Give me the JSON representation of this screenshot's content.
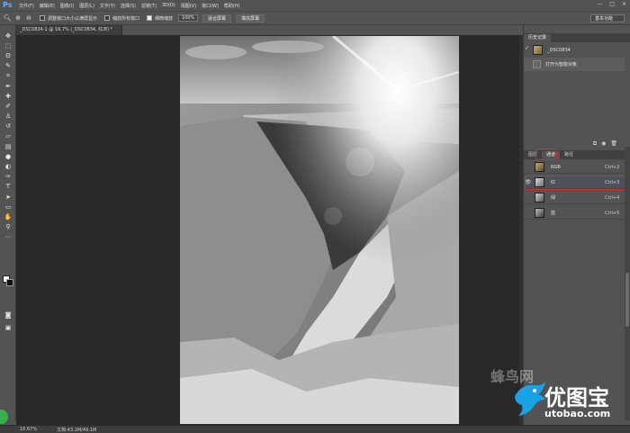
{
  "app": {
    "logo": "Ps"
  },
  "menu": [
    "文件(F)",
    "编辑(E)",
    "图像(I)",
    "图层(L)",
    "文字(Y)",
    "选择(S)",
    "滤镜(T)",
    "3D(D)",
    "视图(V)",
    "窗口(W)",
    "帮助(H)"
  ],
  "window_controls": [
    "—",
    "□",
    "×"
  ],
  "options": {
    "resize_windows_label": "调整窗口大小以满屏显示",
    "zoom_all_label": "缩放所有窗口",
    "scrubby_zoom_label": "细微缩放",
    "zoom_value": "100%",
    "fit_screen_label": "适合屏幕",
    "fill_screen_label": "填充屏幕",
    "workspace": "基本功能"
  },
  "document": {
    "tab_title": "_DSC0834-1 @ 16.7% (_DSC0834, 红/8) *",
    "status_zoom": "16.67%",
    "status_doc": "文档:43.1M/49.1M"
  },
  "history": {
    "tabs": [
      "历史记录"
    ],
    "snapshot_name": "_DSC0834",
    "action_label": "打开为智能对象"
  },
  "channels": {
    "tabs": [
      "图层",
      "通道",
      "路径"
    ],
    "active_tab": "通道",
    "rows": [
      {
        "name": "RGB",
        "shortcut": "Ctrl+2",
        "visible": false,
        "selected": false
      },
      {
        "name": "红",
        "shortcut": "Ctrl+3",
        "visible": true,
        "selected": true
      },
      {
        "name": "绿",
        "shortcut": "Ctrl+4",
        "visible": false,
        "selected": false
      },
      {
        "name": "蓝",
        "shortcut": "Ctrl+5",
        "visible": false,
        "selected": false
      }
    ]
  },
  "watermark": {
    "brand_cn": "优图宝",
    "brand_url": "utobao.com",
    "faint_text": "蜂鸟网"
  },
  "colors": {
    "highlight_red": "#d0302c",
    "watermark_blue": "#1aa2e6"
  }
}
